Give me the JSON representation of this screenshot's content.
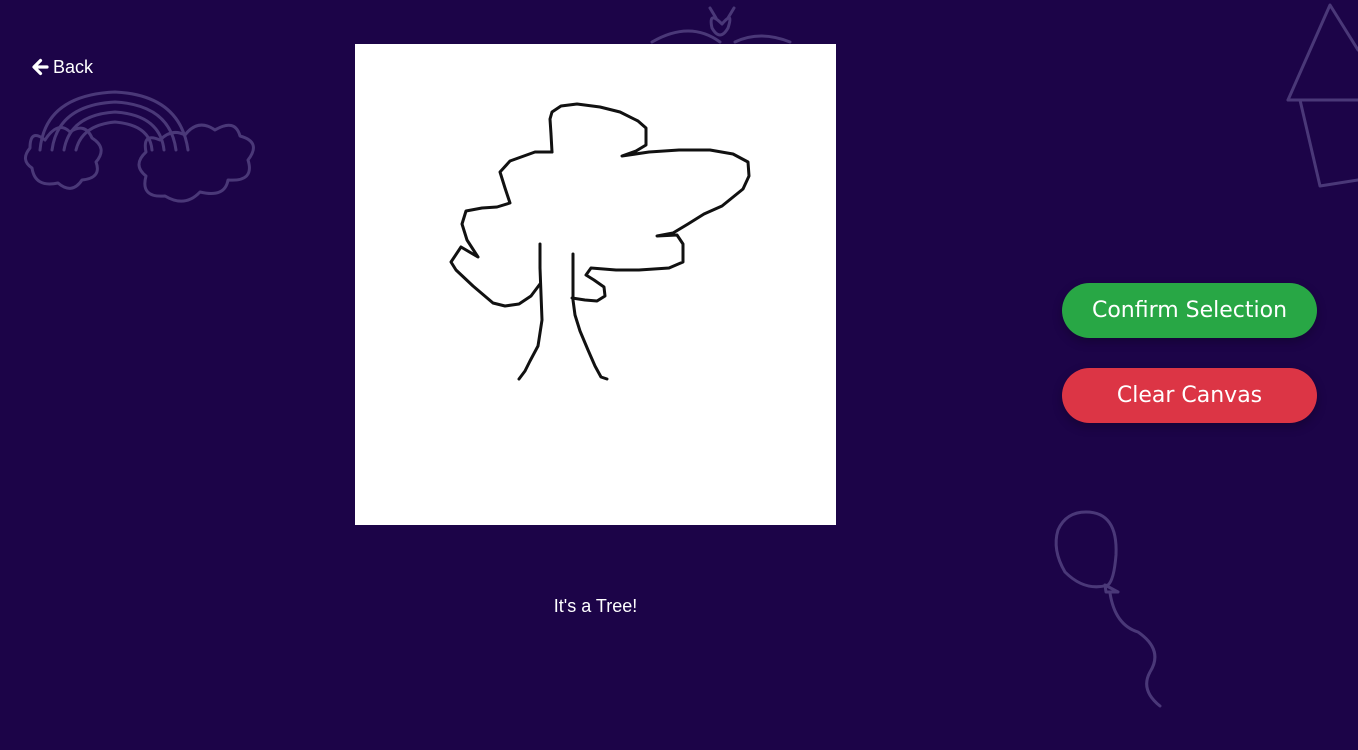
{
  "colors": {
    "background": "#1c0448",
    "doodle_stroke": "#4a3878",
    "canvas_bg": "#ffffff",
    "stroke": "#111111",
    "confirm": "#28a745",
    "clear": "#dc3545",
    "text": "#ffffff"
  },
  "nav": {
    "back_icon": "arrow-left-icon",
    "back_label": "Back"
  },
  "canvas": {
    "drawing": "tree sketch"
  },
  "prediction": {
    "text": "It's a Tree!"
  },
  "actions": {
    "confirm_label": "Confirm Selection",
    "clear_label": "Clear Canvas"
  }
}
